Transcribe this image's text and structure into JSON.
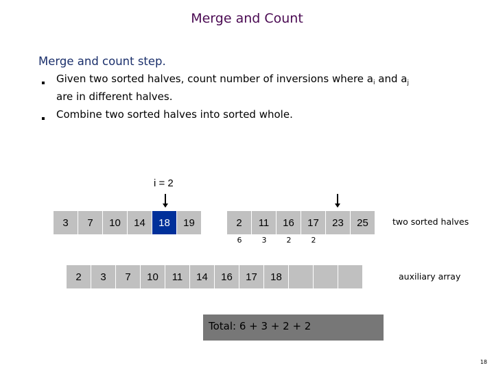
{
  "slide": {
    "title": "Merge and Count",
    "heading": "Merge and count step.",
    "bullets": [
      {
        "text_before": "Given two sorted halves, count number of inversions where a",
        "sub1": "i",
        "mid": " and a",
        "sub2": "j",
        "line2": "are in different halves."
      },
      {
        "text": "Combine two sorted halves into sorted whole."
      }
    ],
    "page_number": "18"
  },
  "diagram": {
    "pointer_i_label": "i = 2",
    "left_half": [
      "3",
      "7",
      "10",
      "14",
      "18",
      "19"
    ],
    "left_highlight_index": 4,
    "right_half": [
      "2",
      "11",
      "16",
      "17",
      "23",
      "25"
    ],
    "right_counts": [
      "6",
      "3",
      "2",
      "2"
    ],
    "right_pointer_index": 4,
    "halves_label": "two sorted halves",
    "auxiliary": [
      "2",
      "3",
      "7",
      "10",
      "11",
      "14",
      "16",
      "17",
      "18",
      "",
      "",
      ""
    ],
    "auxiliary_label": "auxiliary array",
    "total_label": "Total:  6 + 3 + 2 + 2"
  },
  "colors": {
    "title": "#4a0a52",
    "heading": "#1a2f6b",
    "cell": "#c0c0c0",
    "highlight": "#00309a",
    "total_box": "#777777"
  }
}
